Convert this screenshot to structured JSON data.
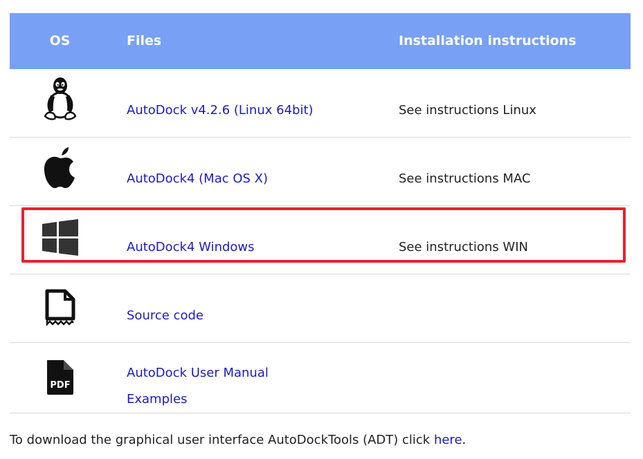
{
  "table": {
    "headers": {
      "os": "OS",
      "files": "Files",
      "install": "Installation instructions"
    },
    "rows": [
      {
        "os_icon": "linux-tux-icon",
        "files": [
          "AutoDock v4.2.6 (Linux 64bit)"
        ],
        "install": "See instructions Linux"
      },
      {
        "os_icon": "apple-icon",
        "files": [
          "AutoDock4 (Mac OS X)"
        ],
        "install": "See instructions MAC"
      },
      {
        "os_icon": "windows-icon",
        "files": [
          "AutoDock4 Windows"
        ],
        "install": "See instructions WIN"
      },
      {
        "os_icon": "source-code-file-icon",
        "files": [
          "Source code"
        ],
        "install": ""
      },
      {
        "os_icon": "pdf-file-icon",
        "files": [
          "AutoDock User Manual",
          "Examples"
        ],
        "install": ""
      }
    ]
  },
  "highlight": {
    "color": "#e8222e",
    "row_index": 2
  },
  "footer": {
    "text_before": "To download the graphical user interface AutoDockTools (ADT) click ",
    "link": "here",
    "text_after": "."
  },
  "colors": {
    "header_bg": "#78a0f5",
    "link": "#1a1acc"
  }
}
